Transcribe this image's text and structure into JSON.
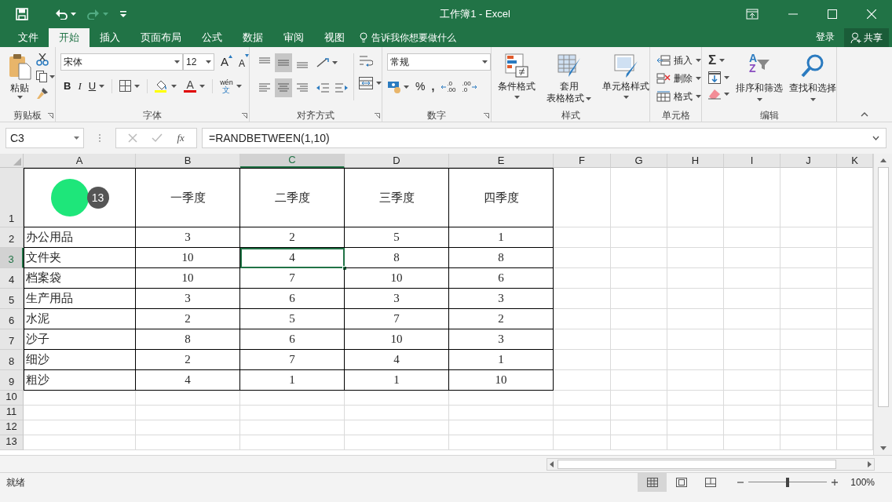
{
  "window": {
    "title": "工作簿1 - Excel"
  },
  "menu_tabs": [
    {
      "label": "文件",
      "selected": false
    },
    {
      "label": "开始",
      "selected": true
    },
    {
      "label": "插入",
      "selected": false
    },
    {
      "label": "页面布局",
      "selected": false
    },
    {
      "label": "公式",
      "selected": false
    },
    {
      "label": "数据",
      "selected": false
    },
    {
      "label": "审阅",
      "selected": false
    },
    {
      "label": "视图",
      "selected": false
    }
  ],
  "tell_me": "告诉我你想要做什么",
  "sign_in": "登录",
  "share": "共享",
  "clipboard": {
    "label": "剪贴板",
    "paste": "粘贴"
  },
  "font": {
    "label": "字体",
    "font_name": "宋体",
    "font_size": "12",
    "grow": "A",
    "shrink": "A",
    "bold": "B",
    "italic": "I",
    "underline": "U",
    "font_color": "A",
    "phonetic": "wén",
    "phonetic_char": "文"
  },
  "alignment": {
    "label": "对齐方式"
  },
  "number": {
    "label": "数字",
    "format": "常规",
    "percent": "%",
    "comma": ",",
    "increase_decimal": [
      ".0",
      ".00"
    ],
    "decrease_decimal": [
      ".00",
      ".0"
    ]
  },
  "styles": {
    "label": "样式",
    "buttons": [
      {
        "lines": [
          "条件格式"
        ]
      },
      {
        "lines": [
          "套用",
          "表格格式"
        ]
      },
      {
        "lines": [
          "单元格样式"
        ]
      }
    ]
  },
  "cells": {
    "label": "单元格",
    "buttons": [
      "插入",
      "删除",
      "格式"
    ]
  },
  "editing": {
    "label": "编辑",
    "autosum": "Σ",
    "sort_letters": [
      "A",
      "Z"
    ],
    "sort_filter": "排序和筛选",
    "find_select": "查找和选择"
  },
  "formula_bar": {
    "name_box": "C3",
    "fx": "fx",
    "formula": "=RANDBETWEEN(1,10)"
  },
  "sheet": {
    "columns": [
      {
        "label": "A",
        "selected": false
      },
      {
        "label": "B",
        "selected": false
      },
      {
        "label": "C",
        "selected": true
      },
      {
        "label": "D",
        "selected": false
      },
      {
        "label": "E",
        "selected": false
      },
      {
        "label": "F",
        "selected": false
      },
      {
        "label": "G",
        "selected": false
      },
      {
        "label": "H",
        "selected": false
      },
      {
        "label": "I",
        "selected": false
      },
      {
        "label": "J",
        "selected": false
      },
      {
        "label": "K",
        "selected": false
      }
    ],
    "header_row": {
      "label": "1",
      "selected": false,
      "cells": [
        {
          "text": "一季度",
          "selected": false
        },
        {
          "text": "二季度",
          "selected": false
        },
        {
          "text": "三季度",
          "selected": false
        },
        {
          "text": "四季度",
          "selected": false
        }
      ]
    },
    "rows": [
      {
        "label": "2",
        "selected": false,
        "cells": [
          {
            "text": "办公用品",
            "selected": false
          },
          {
            "text": "3",
            "selected": false
          },
          {
            "text": "2",
            "selected": false
          },
          {
            "text": "5",
            "selected": false
          },
          {
            "text": "1",
            "selected": false
          }
        ]
      },
      {
        "label": "3",
        "selected": true,
        "cells": [
          {
            "text": "文件夹",
            "selected": false
          },
          {
            "text": "10",
            "selected": false
          },
          {
            "text": "4",
            "selected": true
          },
          {
            "text": "8",
            "selected": false
          },
          {
            "text": "8",
            "selected": false
          }
        ]
      },
      {
        "label": "4",
        "selected": false,
        "cells": [
          {
            "text": "档案袋",
            "selected": false
          },
          {
            "text": "10",
            "selected": false
          },
          {
            "text": "7",
            "selected": false
          },
          {
            "text": "10",
            "selected": false
          },
          {
            "text": "6",
            "selected": false
          }
        ]
      },
      {
        "label": "5",
        "selected": false,
        "cells": [
          {
            "text": "生产用品",
            "selected": false
          },
          {
            "text": "3",
            "selected": false
          },
          {
            "text": "6",
            "selected": false
          },
          {
            "text": "3",
            "selected": false
          },
          {
            "text": "3",
            "selected": false
          }
        ]
      },
      {
        "label": "6",
        "selected": false,
        "cells": [
          {
            "text": "水泥",
            "selected": false
          },
          {
            "text": "2",
            "selected": false
          },
          {
            "text": "5",
            "selected": false
          },
          {
            "text": "7",
            "selected": false
          },
          {
            "text": "2",
            "selected": false
          }
        ]
      },
      {
        "label": "7",
        "selected": false,
        "cells": [
          {
            "text": "沙子",
            "selected": false
          },
          {
            "text": "8",
            "selected": false
          },
          {
            "text": "6",
            "selected": false
          },
          {
            "text": "10",
            "selected": false
          },
          {
            "text": "3",
            "selected": false
          }
        ]
      },
      {
        "label": "8",
        "selected": false,
        "cells": [
          {
            "text": "细沙",
            "selected": false
          },
          {
            "text": "2",
            "selected": false
          },
          {
            "text": "7",
            "selected": false
          },
          {
            "text": "4",
            "selected": false
          },
          {
            "text": "1",
            "selected": false
          }
        ]
      },
      {
        "label": "9",
        "selected": false,
        "cells": [
          {
            "text": "粗沙",
            "selected": false
          },
          {
            "text": "4",
            "selected": false
          },
          {
            "text": "1",
            "selected": false
          },
          {
            "text": "1",
            "selected": false
          },
          {
            "text": "10",
            "selected": false
          }
        ]
      }
    ],
    "empty_rows": [
      {
        "label": "10",
        "selected": false
      },
      {
        "label": "11",
        "selected": false
      },
      {
        "label": "12",
        "selected": false
      },
      {
        "label": "13",
        "selected": false
      }
    ]
  },
  "click_marker": {
    "count": "13"
  },
  "status_bar": {
    "status": "就绪",
    "views": [
      {
        "kind": "normal",
        "selected": true
      },
      {
        "kind": "page_layout",
        "selected": false
      },
      {
        "kind": "page_break",
        "selected": false
      }
    ],
    "zoom_slider": {
      "level": 0.5
    },
    "zoom": "100%"
  }
}
